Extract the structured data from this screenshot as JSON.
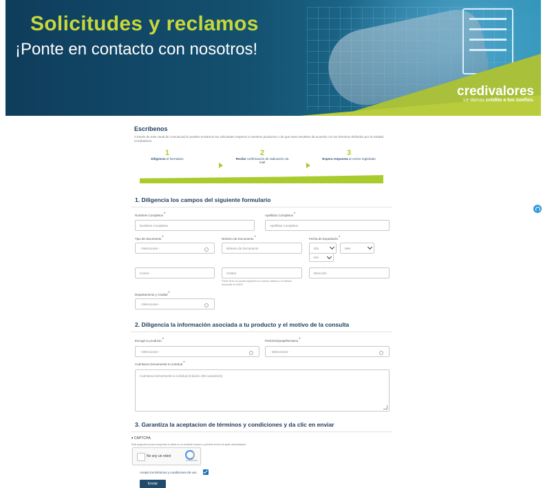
{
  "banner": {
    "title": "Solicitudes y reclamos",
    "subtitle": "¡Ponte en contacto con nosotros!",
    "brand": "credivalores",
    "tagline_pre": "Le damos ",
    "tagline_bold": "crédito a tus sueños."
  },
  "intro": {
    "heading": "Escríbenos",
    "text": "A través de este canal de comunicación puedes enviarnos tus solicitudes respecto a nuestros productos o de que seas resueltos de acuerdo con los términos definidos por la entidad Credivalores."
  },
  "steps": [
    {
      "number": "1",
      "label_bold": "Diligencia",
      "label": " el formulario"
    },
    {
      "number": "2",
      "label_bold": "Recibe",
      "label": " confirmación de radicación vía mail"
    },
    {
      "number": "3",
      "label_bold": "Espera respuesta",
      "label": " al correo registrado"
    }
  ],
  "section1": {
    "title": "1. Diligencia los campos del siguiente formulario",
    "nombres_label": "Nombres Completos",
    "nombres_value": "Nombres Completos",
    "apellidos_label": "Apellidos Completos",
    "apellidos_value": "Apellidos Completos",
    "tipo_doc_label": "Tipo de documento",
    "tipo_doc_value": "- Seleccionar -",
    "num_doc_label": "Número de Documento",
    "num_doc_value": "Número de Documento",
    "fecha_label": "Fecha de Expedición",
    "fecha_dia": "Día",
    "fecha_mes": "Mes",
    "fecha_anio": "Año",
    "correo_value": "Correo",
    "celular_value": "Celular",
    "celular_note": "*Debe tener en cuenta registrarlo en nuestro sistema o el recibido respuesta es EQKS",
    "direccion_value": "Dirección",
    "depto_label": "Departamento y Ciudad",
    "depto_value": "- Seleccionar -"
  },
  "section2": {
    "title": "2. Diligencia la información asociada a tu producto y el motivo de la consulta",
    "producto_label": "Escoge tu producto",
    "producto_value": "- Seleccionar -",
    "peticion_label": "Petición/Queja/Reclamo",
    "peticion_value": "- Seleccionar -",
    "solicitud_label": "Cuéntanos brevemente tu solicitud",
    "solicitud_value": "Cuéntanos brevemente tu solicitud (máximo 250 caracteres)"
  },
  "section3": {
    "title": "3. Garantiza la aceptacion de términos y condiciones y da clic en enviar",
    "captcha_heading": "CAPTCHA",
    "captcha_note": "Esta pregunta es para comprobar si usted es un visitante humano y prevenir envíos de spam automatizado.",
    "recaptcha_label": "No soy un robot",
    "recaptcha_brand": "reCAPTCHA",
    "terms_label": "Acepto los términos y condiciones de uso",
    "submit_label": "Enviar"
  },
  "colors": {
    "accent_green": "#aacb2d",
    "brand_navy": "#1e3a5a",
    "button": "#1f4c6b"
  }
}
